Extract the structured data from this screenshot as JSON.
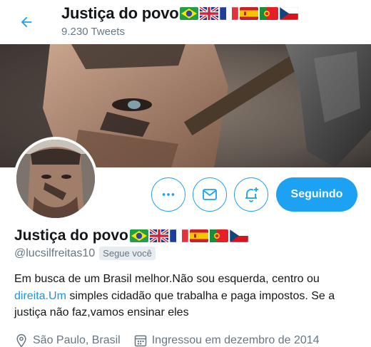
{
  "header": {
    "name": "Justiça do povo",
    "tweets_label": "9.230 Tweets",
    "flags": [
      "brazil-flag-icon",
      "uk-flag-icon",
      "france-flag-icon",
      "spain-flag-icon",
      "portugal-flag-icon",
      "czech-flag-icon"
    ]
  },
  "actions": {
    "more_icon": "more-icon",
    "message_icon": "mail-icon",
    "notify_icon": "bell-plus-icon",
    "follow_label": "Seguindo"
  },
  "profile": {
    "name": "Justiça do povo",
    "handle": "@lucsilfreitas10",
    "follows_you_badge": "Segue você",
    "bio_part1": "Em busca de um Brasil melhor.Não sou esquerda, centro ou ",
    "bio_link": "direita.Um",
    "bio_part2": " simples cidadão que trabalha e paga impostos. Se a justiça não faz,vamos ensinar eles",
    "location": "São Paulo, Brasil",
    "joined": "Ingressou em dezembro de 2014"
  },
  "colors": {
    "accent": "#1da1f2",
    "muted_text": "#657786",
    "link": "#1b95e0"
  }
}
